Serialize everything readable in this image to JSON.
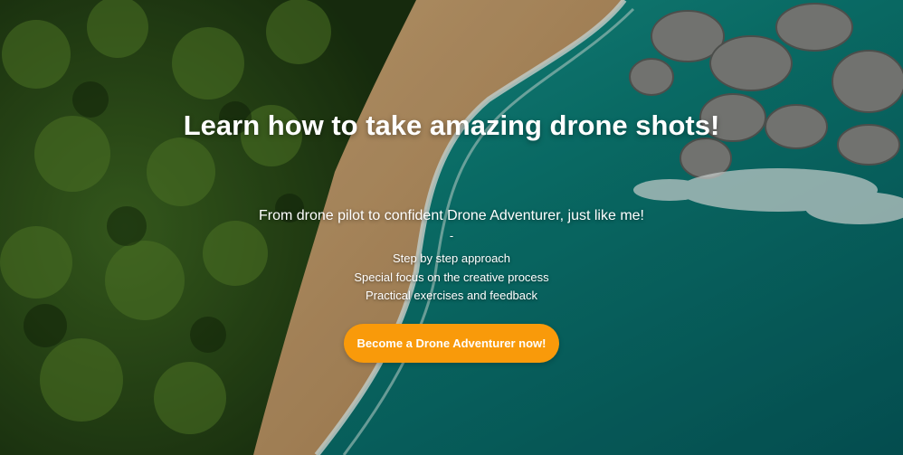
{
  "hero": {
    "title": "Learn how to take amazing drone shots!",
    "subtitle": "From drone pilot to confident Drone Adventurer, just like me!",
    "separator": "-",
    "features": [
      "Step by step approach",
      "Special focus on the creative process",
      "Practical exercises and feedback"
    ],
    "cta_label": "Become a Drone Adventurer now!",
    "cta_color": "#f99a0a"
  }
}
